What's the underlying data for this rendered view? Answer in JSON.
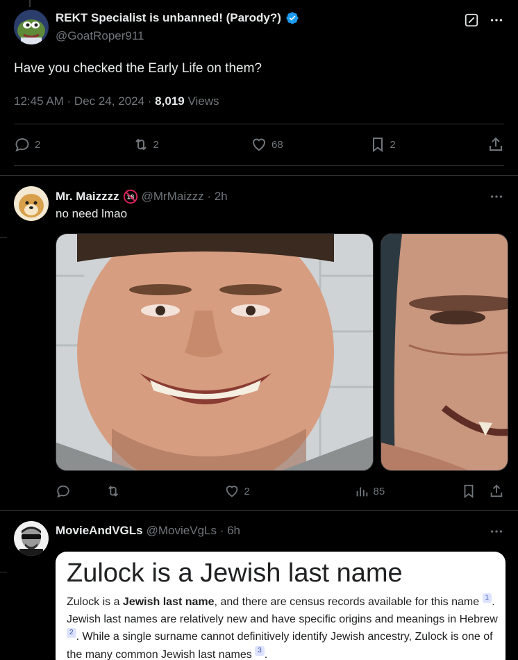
{
  "main_tweet": {
    "author_name": "REKT Specialist is unbanned! (Parody?)",
    "handle": "@GoatRoper911",
    "text": "Have you checked the Early Life on them?",
    "timestamp": "12:45 AM · Dec 24, 2024 · ",
    "views_count": "8,019",
    "views_label": " Views",
    "replies": "2",
    "retweets": "2",
    "likes": "68",
    "bookmarks": "2"
  },
  "reply1": {
    "author_name": "Mr. Maizzzz",
    "badge": "18",
    "handle": "@MrMaizzz · 2h",
    "text": "no need lmao",
    "likes": "2",
    "views": "85"
  },
  "reply2": {
    "author_name": "MovieAndVGLs",
    "handle": "@MovieVgLs · 6h",
    "card": {
      "title": "Zulock is a Jewish last name",
      "p1": "Zulock is a ",
      "p1_bold": "Jewish last name",
      "p1_rest": ", and there are census records available for this name",
      "ref1": "1",
      "p2": ". Jewish last names are relatively new and have specific origins and meanings in Hebrew",
      "ref2": "2",
      "p3": ". While a single surname cannot definitively identify Jewish ancestry, Zulock is one of the many common Jewish last names",
      "ref3": "3",
      "p4": "."
    }
  },
  "colors": {
    "background": "#000000",
    "text": "#e7e9ea",
    "muted": "#71767b",
    "verified": "#1d9bf0",
    "border": "#2f3336"
  }
}
